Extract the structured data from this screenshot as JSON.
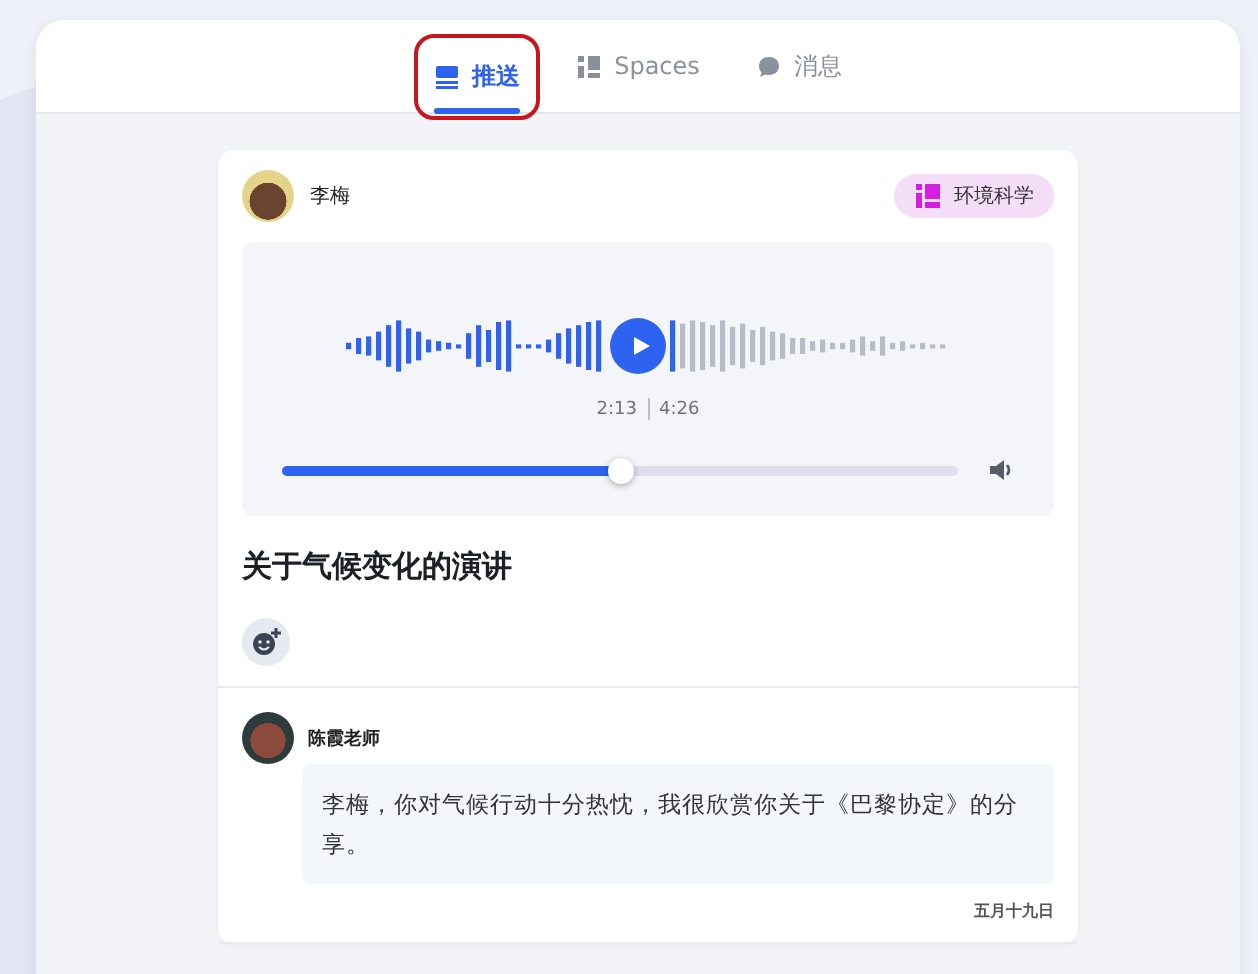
{
  "tabs": [
    {
      "label": "推送",
      "kind": "feed",
      "selected": true,
      "highlighted": true
    },
    {
      "label": "Spaces",
      "kind": "spaces",
      "selected": false,
      "highlighted": false
    },
    {
      "label": "消息",
      "kind": "chat",
      "selected": false,
      "highlighted": false
    }
  ],
  "post": {
    "author": "李梅",
    "tag": "环境科学",
    "audio": {
      "elapsed": "2:13",
      "duration": "4:26",
      "level": 0.5
    },
    "title": "关于气候变化的演讲"
  },
  "comment": {
    "author": "陈霞老师",
    "text": "李梅，你对气候行动十分热忱，我很欣赏你关于《巴黎协定》的分享。",
    "date": "五月十九日"
  }
}
